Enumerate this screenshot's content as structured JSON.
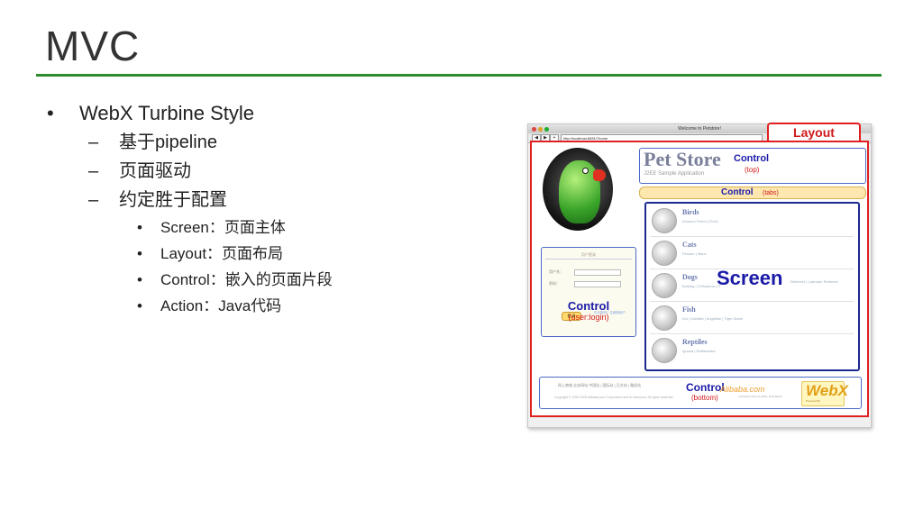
{
  "slide": {
    "title": "MVC",
    "bullets": [
      {
        "level": 1,
        "marker": "•",
        "text": "WebX Turbine Style"
      },
      {
        "level": 2,
        "marker": "–",
        "text": "基于pipeline"
      },
      {
        "level": 2,
        "marker": "–",
        "text": "页面驱动"
      },
      {
        "level": 2,
        "marker": "–",
        "text": "约定胜于配置"
      },
      {
        "level": 3,
        "marker": "•",
        "text": "Screen：页面主体"
      },
      {
        "level": 3,
        "marker": "•",
        "text": "Layout：页面布局"
      },
      {
        "level": 3,
        "marker": "•",
        "text": "Control：嵌入的页面片段"
      },
      {
        "level": 3,
        "marker": "•",
        "text": "Action：Java代码"
      }
    ]
  },
  "screenshot": {
    "window_title": "Welcome to Petstore!",
    "url": "http://localhost:8081/?home",
    "layout_label": "Layout",
    "pet_store": {
      "title": "Pet Store",
      "subtitle": "J2EE Sample Application"
    },
    "login_box": {
      "header": "用户登录",
      "user_label": "用户名：",
      "pass_label": "密码：",
      "button": "登 录",
      "link": "忘记密码？注册新用户"
    },
    "controls": {
      "word": "Control",
      "top": "(top)",
      "tabs": "(tabs)",
      "user_login": "(user:login)",
      "bottom": "(bottom)"
    },
    "screen_label": "Screen",
    "categories": [
      {
        "name": "Birds",
        "desc": "Amazon Parrot | Finch"
      },
      {
        "name": "Cats",
        "desc": "Persian | Manx"
      },
      {
        "name": "Dogs",
        "desc": "Bulldog | Chihuahua | Dalmation | Golden Retriever"
      },
      {
        "name": "Fish",
        "desc": "Koi | Goldfish | Angelfish | Tiger Shark"
      },
      {
        "name": "Reptiles",
        "desc": "Iguana | Rattlesnake"
      }
    ],
    "dogs_extra": "Retriever | Labrador Retriever",
    "footer": {
      "links": "网上商城 业务网站  中国站 | 国际站 | 日文站 | 雅虎站",
      "copyright": "Copyright © 1999-2005 Alibaba.com Corporation and its licensors. All rights reserved.",
      "alibaba": "Alibaba.com",
      "alibaba_sub": "CONNECTING GLOBAL BUSINESS",
      "webx": "WebX",
      "webx_sub": "Powered By"
    }
  }
}
